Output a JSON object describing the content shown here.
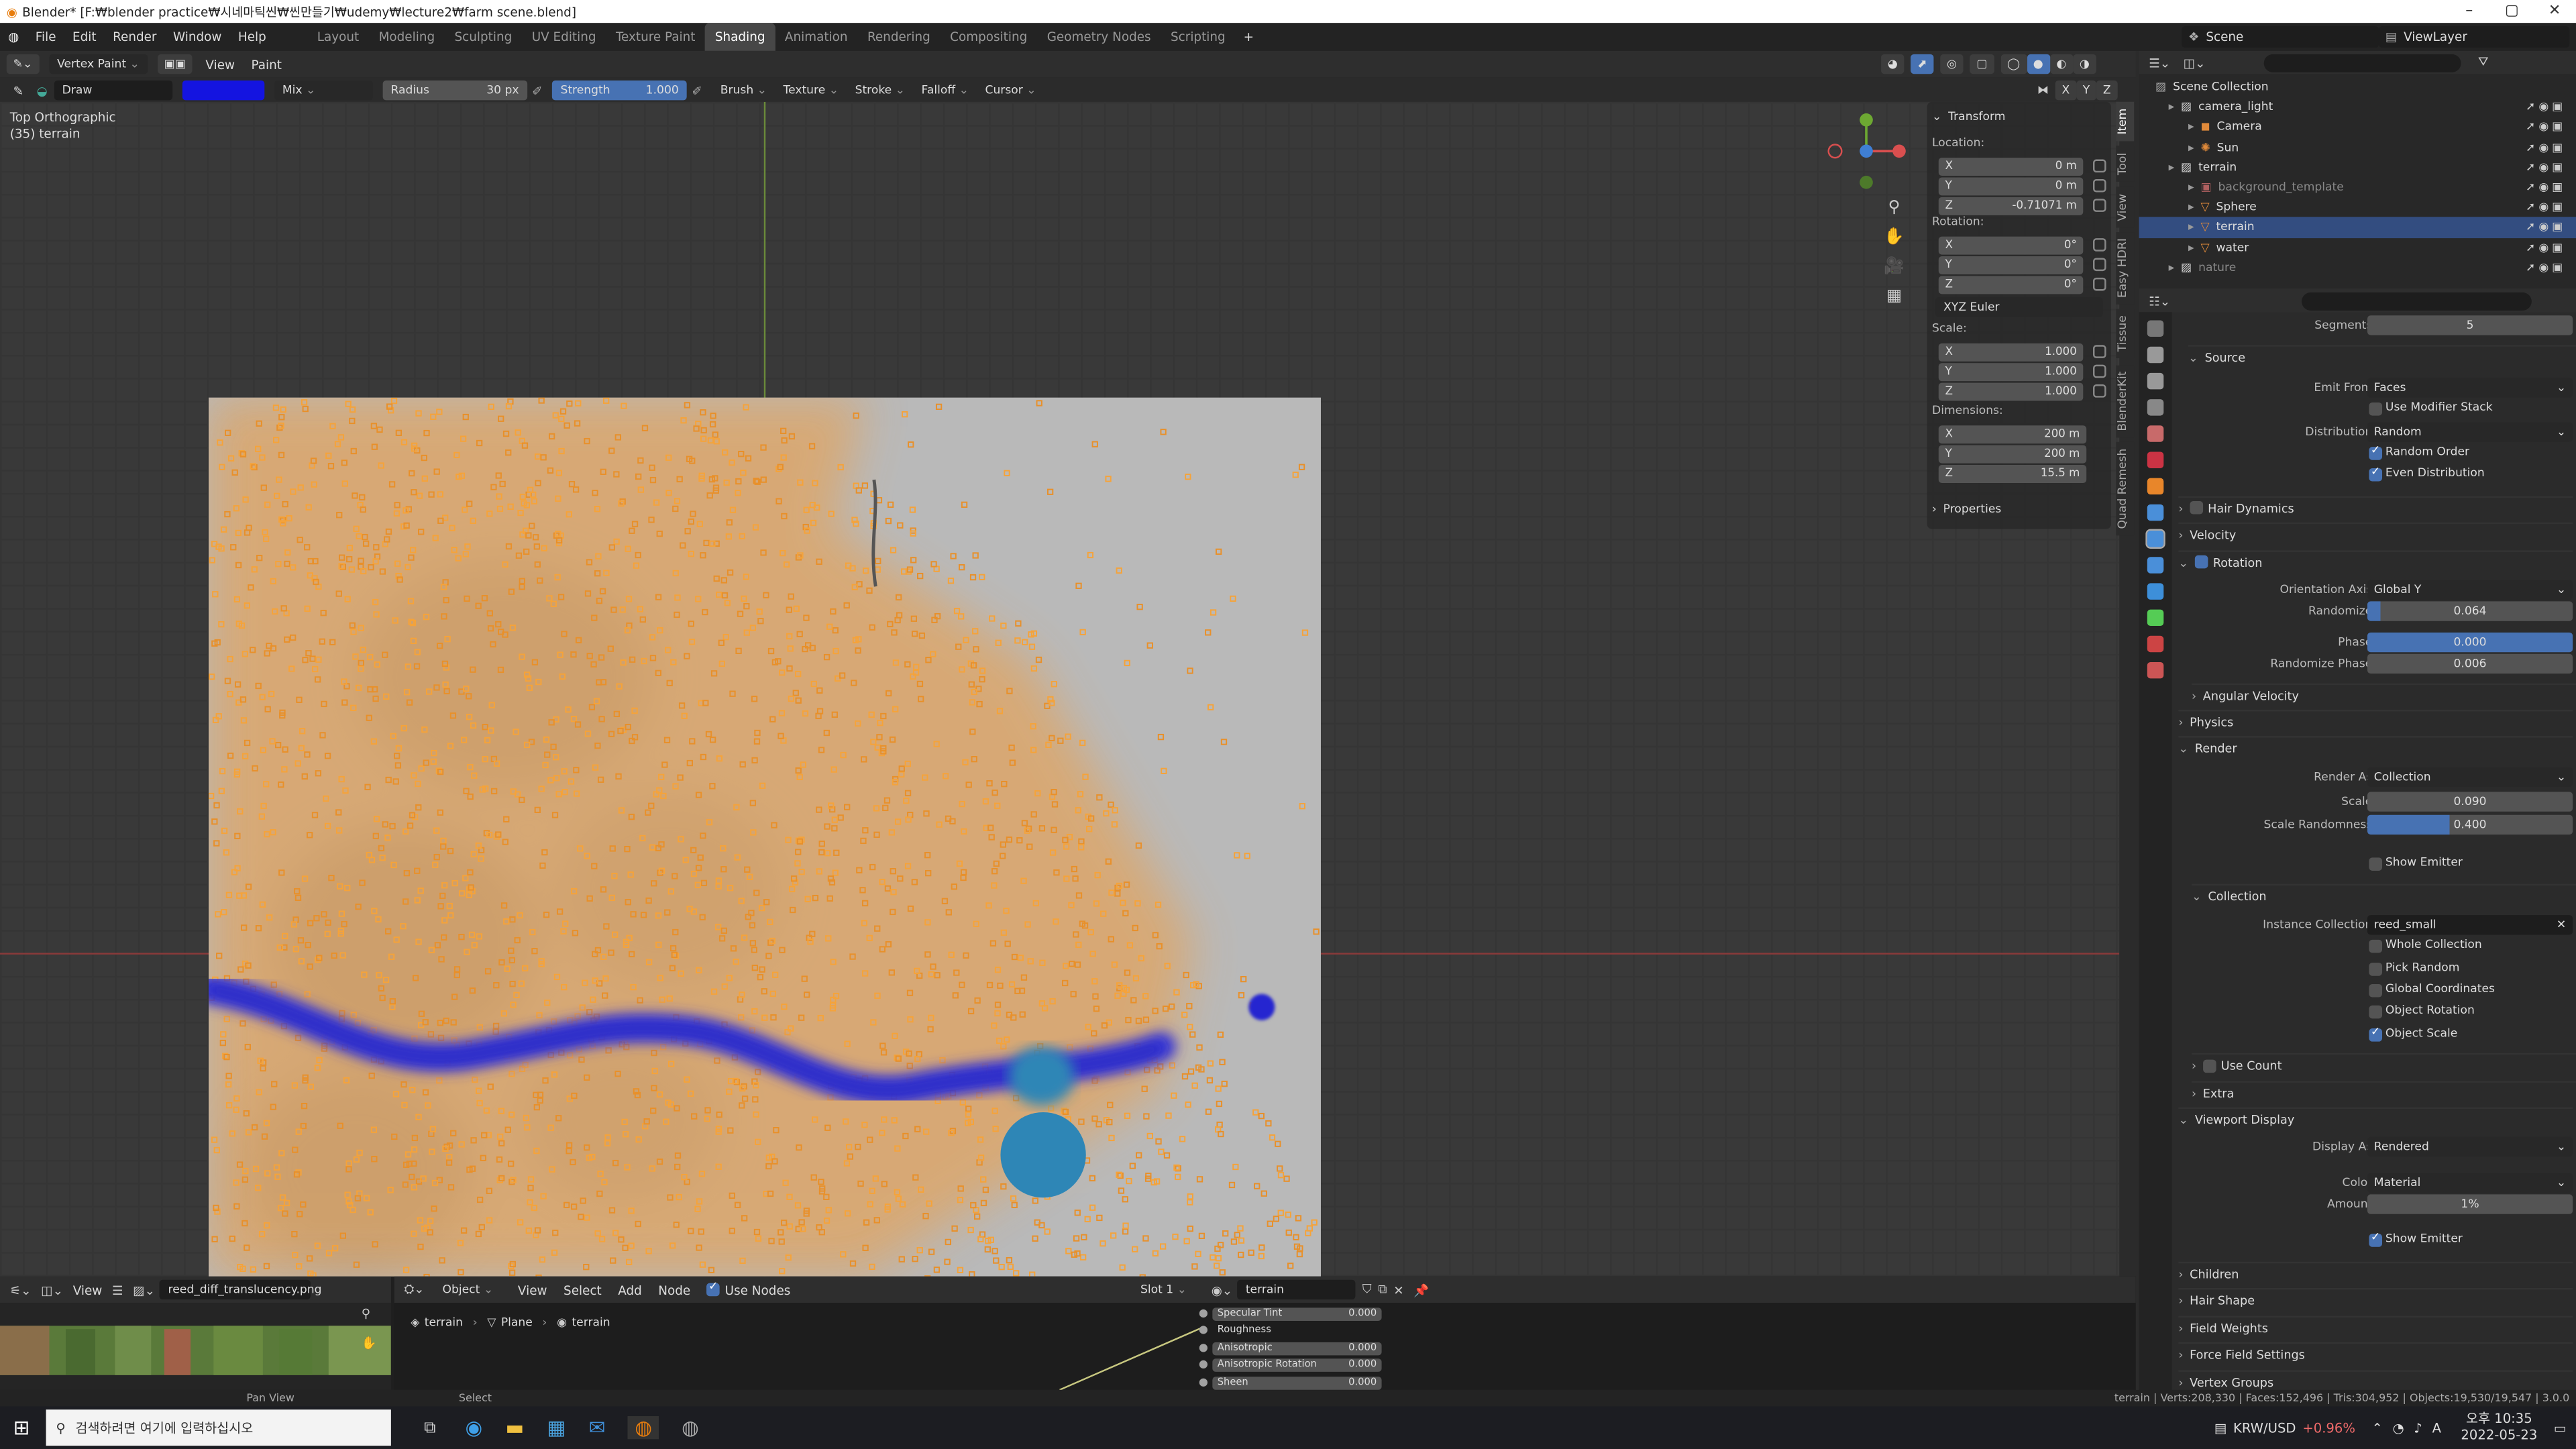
{
  "window": {
    "title": "Blender* [F:₩blender practice₩시네마틱씬₩씬만들기₩udemy₩lecture2₩farm scene.blend]"
  },
  "menu": [
    "File",
    "Edit",
    "Render",
    "Window",
    "Help"
  ],
  "workspaces": [
    "Layout",
    "Modeling",
    "Sculpting",
    "UV Editing",
    "Texture Paint",
    "Shading",
    "Animation",
    "Rendering",
    "Compositing",
    "Geometry Nodes",
    "Scripting"
  ],
  "active_workspace": "Shading",
  "scene": "Scene",
  "viewlayer": "ViewLayer",
  "toolheader": {
    "mode": "Vertex Paint",
    "view": "View",
    "paint": "Paint",
    "brush_name": "Draw",
    "blend": "Mix",
    "radius_label": "Radius",
    "radius": "30 px",
    "strength_label": "Strength",
    "strength": "1.000",
    "brush": "Brush",
    "texture": "Texture",
    "stroke": "Stroke",
    "falloff": "Falloff",
    "cursor": "Cursor",
    "brush_color": "#1414e0"
  },
  "viewport": {
    "view_name": "Top Orthographic",
    "object_label": "(35) terrain",
    "axes": {
      "x": "X",
      "y": "Y",
      "z": "Z"
    }
  },
  "npanel": {
    "title": "Transform",
    "location": "Location:",
    "loc": [
      [
        "X",
        "0 m"
      ],
      [
        "Y",
        "0 m"
      ],
      [
        "Z",
        "-0.71071 m"
      ]
    ],
    "rotation": "Rotation:",
    "rot": [
      [
        "X",
        "0°"
      ],
      [
        "Y",
        "0°"
      ],
      [
        "Z",
        "0°"
      ]
    ],
    "rot_mode": "XYZ Euler",
    "scale": "Scale:",
    "scl": [
      [
        "X",
        "1.000"
      ],
      [
        "Y",
        "1.000"
      ],
      [
        "Z",
        "1.000"
      ]
    ],
    "dimensions": "Dimensions:",
    "dim": [
      [
        "X",
        "200 m"
      ],
      [
        "Y",
        "200 m"
      ],
      [
        "Z",
        "15.5 m"
      ]
    ],
    "properties": "Properties"
  },
  "side_tabs": [
    "Item",
    "Tool",
    "View",
    "Easy HDRI",
    "Tissue",
    "BlenderKit",
    "Quad Remesh"
  ],
  "outliner": {
    "title": "Scene Collection",
    "rows": [
      {
        "indent": 0,
        "name": "camera_light",
        "icon": "collection"
      },
      {
        "indent": 1,
        "name": "Camera",
        "icon": "camera"
      },
      {
        "indent": 1,
        "name": "Sun",
        "icon": "light"
      },
      {
        "indent": 0,
        "name": "terrain",
        "icon": "collection"
      },
      {
        "indent": 1,
        "name": "background_template",
        "icon": "image"
      },
      {
        "indent": 1,
        "name": "Sphere",
        "icon": "mesh"
      },
      {
        "indent": 1,
        "name": "terrain",
        "icon": "mesh",
        "selected": true
      },
      {
        "indent": 1,
        "name": "water",
        "icon": "mesh"
      },
      {
        "indent": 0,
        "name": "nature",
        "icon": "collection"
      }
    ]
  },
  "props": {
    "segments_label": "Segments",
    "segments": "5",
    "source": "Source",
    "emit_from_label": "Emit From",
    "emit_from": "Faces",
    "use_modifier_stack": "Use Modifier Stack",
    "distribution_label": "Distribution",
    "distribution": "Random",
    "random_order": "Random Order",
    "even_distribution": "Even Distribution",
    "hair_dynamics": "Hair Dynamics",
    "velocity": "Velocity",
    "rotation": "Rotation",
    "orientation_axis_label": "Orientation Axis",
    "orientation_axis": "Global Y",
    "randomize_label": "Randomize",
    "randomize": "0.064",
    "randomize_frac": 0.064,
    "phase_label": "Phase",
    "phase": "0.000",
    "randomize_phase_label": "Randomize Phase",
    "randomize_phase": "0.006",
    "angular_velocity": "Angular Velocity",
    "physics": "Physics",
    "render": "Render",
    "render_as_label": "Render As",
    "render_as": "Collection",
    "scale_label": "Scale",
    "scale": "0.090",
    "scale_randomness_label": "Scale Randomness",
    "scale_randomness": "0.400",
    "scale_randomness_frac": 0.4,
    "show_emitter": "Show Emitter",
    "collection": "Collection",
    "instance_collection_label": "Instance Collection",
    "instance_collection": "reed_small",
    "whole_collection": "Whole Collection",
    "pick_random": "Pick Random",
    "global_coordinates": "Global Coordinates",
    "object_rotation": "Object Rotation",
    "object_scale": "Object Scale",
    "use_count": "Use Count",
    "extra": "Extra",
    "viewport_display": "Viewport Display",
    "display_as_label": "Display As",
    "display_as": "Rendered",
    "color_label": "Color",
    "color": "Material",
    "amount_label": "Amount",
    "amount": "1%",
    "show_emitter2": "Show Emitter",
    "children": "Children",
    "hair_shape": "Hair Shape",
    "field_weights": "Field Weights",
    "force_field_settings": "Force Field Settings",
    "vertex_groups": "Vertex Groups"
  },
  "bottom": {
    "view": "View",
    "image": "reed_diff_translucency.png",
    "object": "Object",
    "view2": "View",
    "select": "Select",
    "add": "Add",
    "node": "Node",
    "use_nodes": "Use Nodes",
    "slot": "Slot 1",
    "material": "terrain",
    "breadcrumb": [
      "terrain",
      "Plane",
      "terrain"
    ],
    "node_rows": [
      [
        "Specular Tint",
        "0.000"
      ],
      [
        "Roughness",
        ""
      ],
      [
        "Anisotropic",
        "0.000"
      ],
      [
        "Anisotropic Rotation",
        "0.000"
      ],
      [
        "Sheen",
        "0.000"
      ]
    ]
  },
  "status": {
    "pan": "Pan View",
    "select": "Select",
    "stats": "terrain | Verts:208,330 | Faces:152,496 | Tris:304,952 | Objects:19,530/19,547 | 3.0.0"
  },
  "taskbar": {
    "search": "검색하려면 여기에 입력하십시오",
    "ticker": "KRW/USD",
    "change": "+0.96%",
    "time": "오후 10:35",
    "date": "2022-05-23"
  }
}
